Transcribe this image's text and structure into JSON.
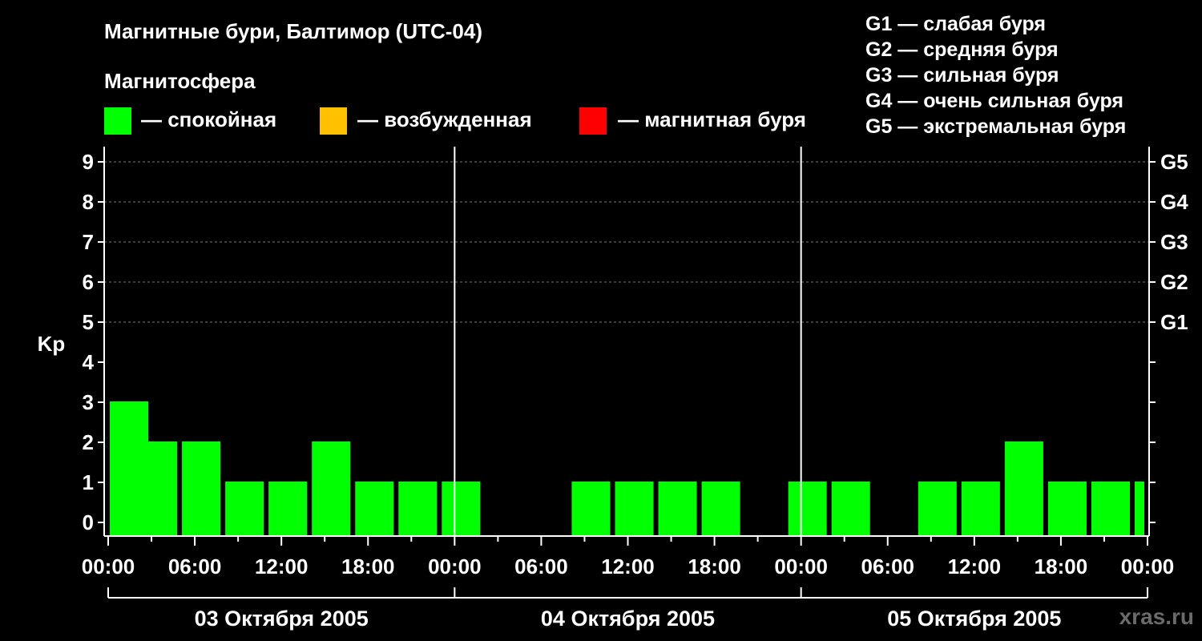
{
  "title": "Магнитные бури, Балтимор (UTC-04)",
  "magnetosphere_label": "Магнитосфера",
  "legend": [
    {
      "label": "— спокойная",
      "color": "#00ff00"
    },
    {
      "label": "— возбужденная",
      "color": "#ffc000"
    },
    {
      "label": "— магнитная буря",
      "color": "#ff0000"
    }
  ],
  "g_scale": [
    "G1 — слабая буря",
    "G2 — средняя буря",
    "G3 — сильная буря",
    "G4 — очень сильная буря",
    "G5 — экстремальная буря"
  ],
  "watermark": "xras.ru",
  "chart_data": {
    "type": "bar",
    "ylabel": "Kp",
    "ylim": [
      0,
      9
    ],
    "yticks": [
      0,
      1,
      2,
      3,
      4,
      5,
      6,
      7,
      8,
      9
    ],
    "right_ticks": [
      {
        "label": "G1",
        "kp": 5
      },
      {
        "label": "G2",
        "kp": 6
      },
      {
        "label": "G3",
        "kp": 7
      },
      {
        "label": "G4",
        "kp": 8
      },
      {
        "label": "G5",
        "kp": 9
      }
    ],
    "grid": "dashed horizontal at Kp 5-9",
    "xlim_hours": [
      0,
      72
    ],
    "xtick_labels": [
      "00:00",
      "06:00",
      "12:00",
      "18:00",
      "00:00",
      "06:00",
      "12:00",
      "18:00",
      "00:00",
      "06:00",
      "12:00",
      "18:00",
      "00:00"
    ],
    "days": [
      "03 Октября 2005",
      "04 Октября 2005",
      "05 Октября 2005"
    ],
    "bars": [
      {
        "start_hour": 0,
        "kp": 3
      },
      {
        "start_hour": 2,
        "kp": 2
      },
      {
        "start_hour": 5,
        "kp": 2
      },
      {
        "start_hour": 8,
        "kp": 1
      },
      {
        "start_hour": 11,
        "kp": 1
      },
      {
        "start_hour": 14,
        "kp": 2
      },
      {
        "start_hour": 17,
        "kp": 1
      },
      {
        "start_hour": 20,
        "kp": 1
      },
      {
        "start_hour": 23,
        "kp": 1
      },
      {
        "start_hour": 32,
        "kp": 1
      },
      {
        "start_hour": 35,
        "kp": 1
      },
      {
        "start_hour": 38,
        "kp": 1
      },
      {
        "start_hour": 41,
        "kp": 1
      },
      {
        "start_hour": 47,
        "kp": 1
      },
      {
        "start_hour": 50,
        "kp": 1
      },
      {
        "start_hour": 56,
        "kp": 1
      },
      {
        "start_hour": 59,
        "kp": 1
      },
      {
        "start_hour": 62,
        "kp": 2
      },
      {
        "start_hour": 65,
        "kp": 1
      },
      {
        "start_hour": 68,
        "kp": 1
      },
      {
        "start_hour": 71,
        "kp": 1
      }
    ],
    "bar_color": "#00ff00"
  }
}
